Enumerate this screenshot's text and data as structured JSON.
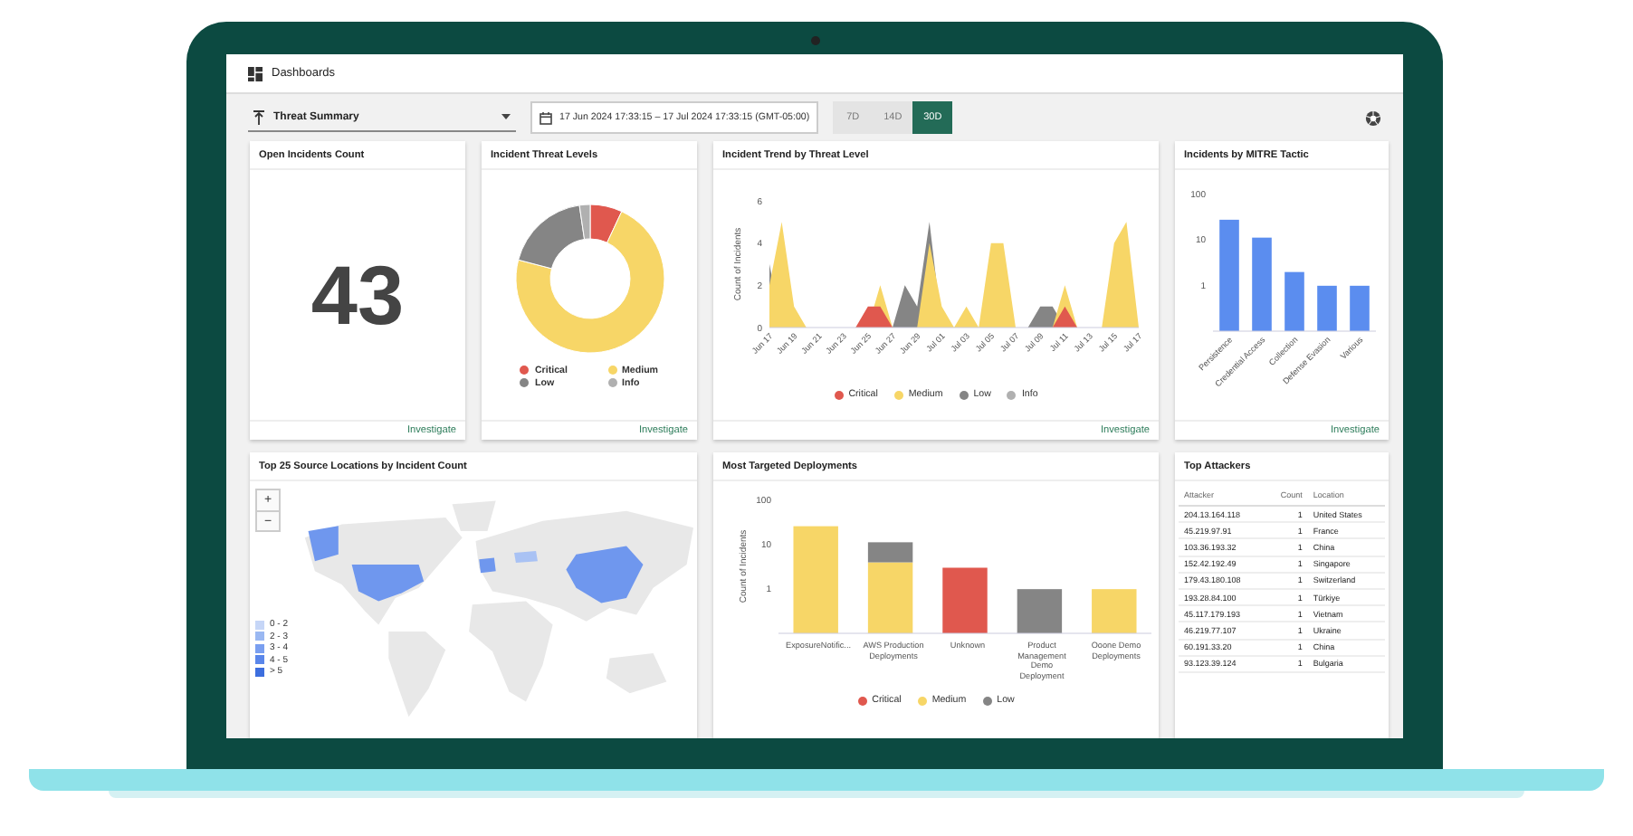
{
  "app_bar": {
    "title": "Dashboards"
  },
  "toolbar": {
    "dashboard": "Threat Summary",
    "date_range": "17 Jun 2024 17:33:15 – 17 Jul 2024 17:33:15 (GMT-05:00)",
    "ranges": [
      {
        "label": "7D",
        "selected": false
      },
      {
        "label": "14D",
        "selected": false
      },
      {
        "label": "30D",
        "selected": true
      }
    ]
  },
  "open_incidents": {
    "title": "Open Incidents Count",
    "value": "43",
    "link": "Investigate"
  },
  "threat_levels": {
    "title": "Incident Threat Levels",
    "link": "Investigate",
    "legend": [
      {
        "label": "Critical",
        "color": "#e0584e"
      },
      {
        "label": "Medium",
        "color": "#f7d667"
      },
      {
        "label": "Low",
        "color": "#858585"
      },
      {
        "label": "Info",
        "color": "#b0b0b0"
      }
    ]
  },
  "incident_trend": {
    "title": "Incident Trend by Threat Level",
    "link": "Investigate",
    "chart_data": {
      "type": "area",
      "stacked": false,
      "ylabel": "Count of Incidents",
      "categories": [
        "Jun 17",
        null,
        "Jun 19",
        null,
        "Jun 21",
        null,
        "Jun 23",
        null,
        "Jun 25",
        null,
        "Jun 27",
        null,
        "Jun 29",
        null,
        "Jul 01",
        null,
        "Jul 03",
        null,
        "Jul 05",
        null,
        "Jul 07",
        null,
        "Jul 09",
        null,
        "Jul 11",
        null,
        "Jul 13",
        null,
        "Jul 15",
        null,
        "Jul 17"
      ],
      "ylim": [
        0,
        6
      ],
      "yticks": [
        0,
        2,
        4,
        6
      ],
      "series": [
        {
          "name": "Critical",
          "color": "#e0584e",
          "values": [
            null,
            null,
            null,
            null,
            null,
            null,
            null,
            0,
            1,
            1,
            0,
            0,
            0,
            0,
            0,
            0,
            0,
            0,
            0,
            0,
            0,
            0,
            0,
            0,
            1,
            0,
            null,
            null,
            null,
            null,
            null
          ]
        },
        {
          "name": "Medium",
          "color": "#f7d667",
          "values": [
            2,
            5,
            1,
            0,
            0,
            0,
            0,
            0,
            0,
            2,
            0,
            0,
            0,
            4,
            1,
            0,
            1,
            0,
            4,
            4,
            0,
            0,
            0,
            0,
            2,
            0,
            0,
            0,
            4,
            5,
            0
          ]
        },
        {
          "name": "Low",
          "color": "#858585",
          "values": [
            3,
            0,
            0,
            0,
            0,
            0,
            0,
            0,
            0,
            0,
            0,
            2,
            1,
            5,
            0,
            0,
            0,
            0,
            0,
            0,
            0,
            0,
            1,
            1,
            0,
            null,
            null,
            null,
            null,
            null,
            null
          ]
        },
        {
          "name": "Info",
          "color": "#b0b0b0",
          "values": [
            null,
            null,
            null,
            null,
            null,
            null,
            null,
            null,
            null,
            null,
            null,
            null,
            null,
            null,
            null,
            null,
            null,
            null,
            null,
            null,
            null,
            null,
            null,
            null,
            null,
            null,
            null,
            null,
            null,
            null,
            null
          ]
        }
      ]
    }
  },
  "mitre_tactics": {
    "title": "Incidents by MITRE Tactic",
    "link": "Investigate",
    "y_axis_labels": [
      "100",
      "10",
      "1"
    ],
    "x_axis_labels": [
      "Persistence",
      "Credential Access",
      "Collection",
      "Defense Evasion",
      "Various"
    ]
  },
  "source_locations": {
    "title": "Top 25 Source Locations by Incident Count",
    "zoom_in": "+",
    "zoom_out": "−",
    "legend": [
      {
        "label": "0 - 2",
        "color": "#c6d6f7"
      },
      {
        "label": "2 - 3",
        "color": "#9ab8f2"
      },
      {
        "label": "3 - 4",
        "color": "#7a9ff0"
      },
      {
        "label": "4 - 5",
        "color": "#5a86ea"
      },
      {
        "label": "> 5",
        "color": "#3d6ede"
      }
    ]
  },
  "targeted_deployments": {
    "title": "Most Targeted Deployments",
    "y_axis_title": "Count of Incidents",
    "y_axis_labels": [
      "100",
      "10",
      "1"
    ],
    "x_axis_labels": [
      "ExposureNotific...",
      "AWS Production Deployments",
      "Unknown",
      "Product Management Demo Deployment",
      "Ooone Demo Deployments"
    ],
    "legend": [
      {
        "label": "Critical",
        "color": "#e0584e"
      },
      {
        "label": "Medium",
        "color": "#f7d667"
      },
      {
        "label": "Low",
        "color": "#858585"
      }
    ]
  },
  "top_attackers": {
    "title": "Top Attackers",
    "columns": [
      "Attacker",
      "Count",
      "Location"
    ],
    "rows": [
      [
        "204.13.164.118",
        "1",
        "United States"
      ],
      [
        "45.219.97.91",
        "1",
        "France"
      ],
      [
        "103.36.193.32",
        "1",
        "China"
      ],
      [
        "152.42.192.49",
        "1",
        "Singapore"
      ],
      [
        "179.43.180.108",
        "1",
        "Switzerland"
      ],
      [
        "193.28.84.100",
        "1",
        "Türkiye"
      ],
      [
        "45.117.179.193",
        "1",
        "Vietnam"
      ],
      [
        "46.219.77.107",
        "1",
        "Ukraine"
      ],
      [
        "60.191.33.20",
        "1",
        "China"
      ],
      [
        "93.123.39.124",
        "1",
        "Bulgaria"
      ]
    ]
  }
}
